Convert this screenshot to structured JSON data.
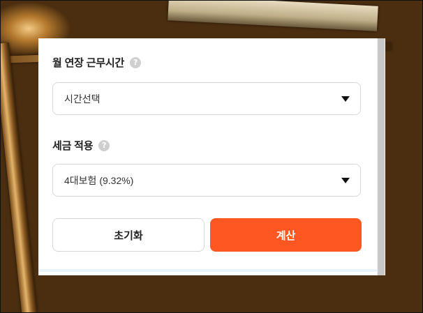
{
  "overtime": {
    "label": "월 연장 근무시간",
    "help_icon": "?",
    "selected": "시간선택"
  },
  "tax": {
    "label": "세금 적용",
    "help_icon": "?",
    "selected": "4대보험 (9.32%)"
  },
  "buttons": {
    "reset_label": "초기화",
    "calculate_label": "계산"
  },
  "colors": {
    "accent": "#ff5722",
    "help_icon_bg": "#cfcfcf",
    "border": "#d5d8db"
  },
  "icons": {
    "help": "question-circle-icon",
    "dropdown": "caret-down-icon"
  }
}
